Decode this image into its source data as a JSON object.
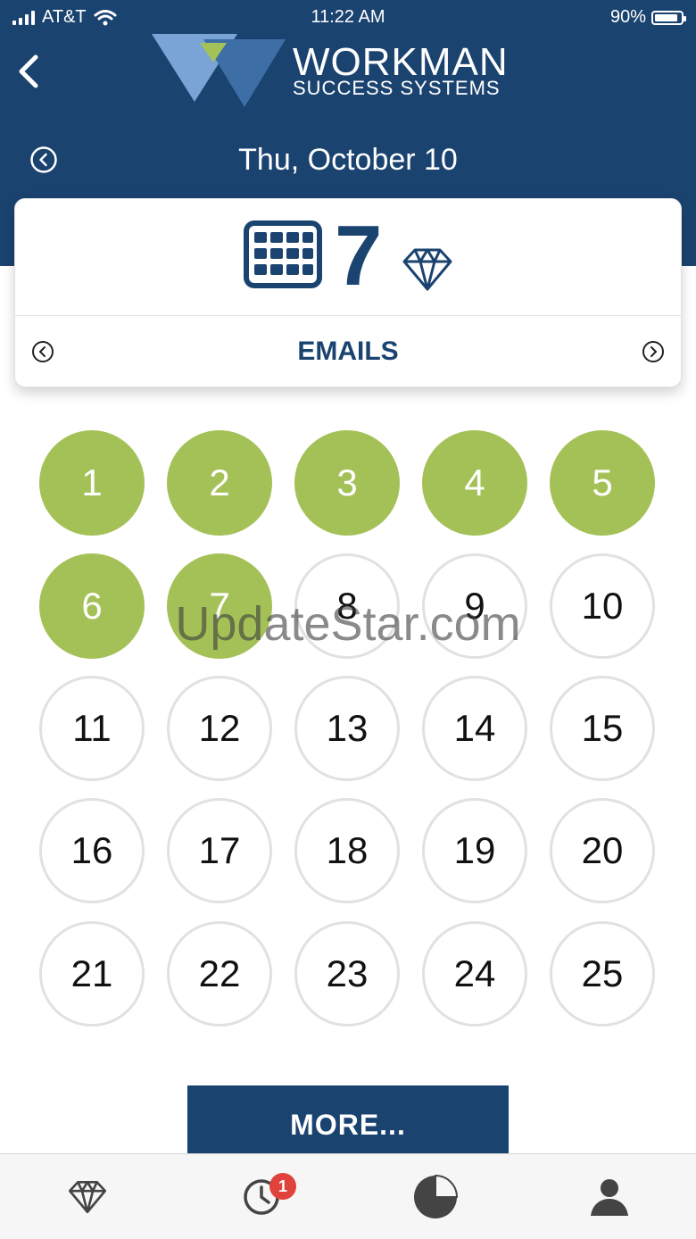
{
  "status_bar": {
    "carrier": "AT&T",
    "time": "11:22 AM",
    "battery": "90%",
    "battery_level": 0.9
  },
  "header": {
    "brand_line1": "WORKMAN",
    "brand_line2": "SUCCESS SYSTEMS",
    "date": "Thu, October 10",
    "color": "#1b4370"
  },
  "summary": {
    "count": "7",
    "category": "EMAILS"
  },
  "tracker": {
    "completed_color": "#a4c157",
    "circles": [
      {
        "label": "1",
        "done": true
      },
      {
        "label": "2",
        "done": true
      },
      {
        "label": "3",
        "done": true
      },
      {
        "label": "4",
        "done": true
      },
      {
        "label": "5",
        "done": true
      },
      {
        "label": "6",
        "done": true
      },
      {
        "label": "7",
        "done": true
      },
      {
        "label": "8",
        "done": false
      },
      {
        "label": "9",
        "done": false
      },
      {
        "label": "10",
        "done": false
      },
      {
        "label": "11",
        "done": false
      },
      {
        "label": "12",
        "done": false
      },
      {
        "label": "13",
        "done": false
      },
      {
        "label": "14",
        "done": false
      },
      {
        "label": "15",
        "done": false
      },
      {
        "label": "16",
        "done": false
      },
      {
        "label": "17",
        "done": false
      },
      {
        "label": "18",
        "done": false
      },
      {
        "label": "19",
        "done": false
      },
      {
        "label": "20",
        "done": false
      },
      {
        "label": "21",
        "done": false
      },
      {
        "label": "22",
        "done": false
      },
      {
        "label": "23",
        "done": false
      },
      {
        "label": "24",
        "done": false
      },
      {
        "label": "25",
        "done": false
      }
    ]
  },
  "watermark": "UpdateStar.com",
  "more_button": "MORE...",
  "tabbar": {
    "tabs": [
      {
        "icon": "diamond-icon"
      },
      {
        "icon": "clock-icon",
        "badge": "1"
      },
      {
        "icon": "pie-chart-icon"
      },
      {
        "icon": "profile-icon"
      }
    ]
  }
}
